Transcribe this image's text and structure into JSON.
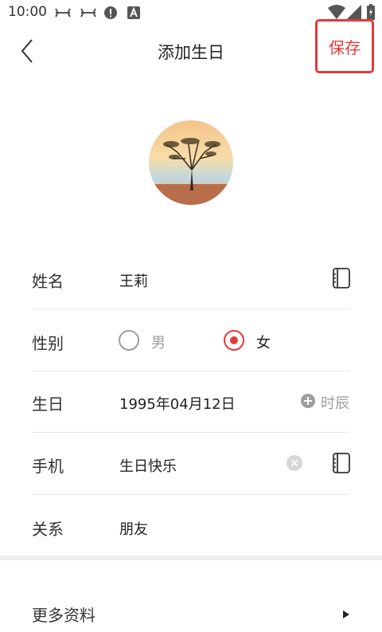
{
  "status": {
    "time": "10:00"
  },
  "header": {
    "title": "添加生日",
    "save_label": "保存"
  },
  "form": {
    "name": {
      "label": "姓名",
      "value": "王莉"
    },
    "gender": {
      "label": "性别",
      "male": "男",
      "female": "女",
      "selected": "女"
    },
    "birthday": {
      "label": "生日",
      "value": "1995年04月12日",
      "hour_label": "时辰"
    },
    "phone": {
      "label": "手机",
      "value": "生日快乐"
    },
    "relation": {
      "label": "关系",
      "value": "朋友"
    }
  },
  "more": {
    "label": "更多资料"
  },
  "colors": {
    "accent": "#e53935"
  }
}
